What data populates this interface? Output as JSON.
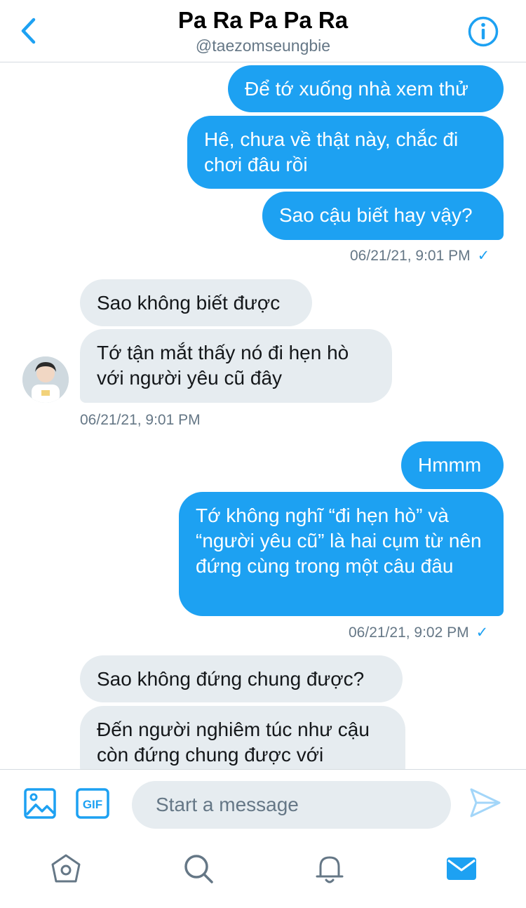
{
  "header": {
    "title": "Pa Ra Pa Pa Ra",
    "handle": "@taezomseungbie",
    "back_icon": "chevron-left-icon",
    "info_icon": "info-circle-icon"
  },
  "messages": {
    "m1": "Để tớ xuống nhà xem thử",
    "m2": "Hê, chưa về thật này, chắc đi chơi đâu rồi",
    "m3": "Sao cậu biết hay vậy?",
    "t1": "06/21/21, 9:01 PM",
    "m4": "Sao không biết được",
    "m5": "Tớ tận mắt thấy nó đi hẹn hò với người yêu cũ đây",
    "t2": "06/21/21, 9:01 PM",
    "m6": "Hmmm",
    "m7": "Tớ không nghĩ “đi hẹn hò” và “người yêu cũ” là hai cụm từ nên đứng cùng trong một câu đâu",
    "t3": "06/21/21, 9:02 PM",
    "m8": "Sao không đứng chung được?",
    "m9": "Đến người nghiêm túc như cậu còn đứng chung được với",
    "check": "✓"
  },
  "composer": {
    "placeholder": "Start a message",
    "image_icon": "image-icon",
    "gif_label": "GIF",
    "send_icon": "send-icon"
  },
  "tabs": {
    "items": [
      "home-icon",
      "search-icon",
      "bell-icon",
      "mail-icon"
    ],
    "active": "mail-icon"
  },
  "colors": {
    "accent": "#1da1f2",
    "incoming_bubble": "#e6ecf0",
    "secondary_text": "#657786",
    "icon_gray": "#657786"
  }
}
